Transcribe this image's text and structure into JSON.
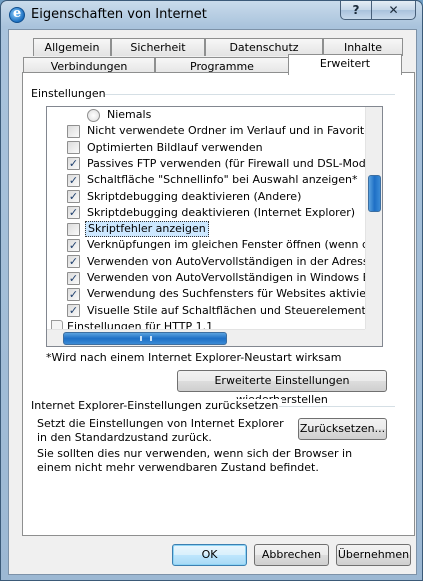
{
  "window": {
    "title": "Eigenschaften von Internet",
    "help_glyph": "?",
    "close_glyph": "✕"
  },
  "tabs_row1": [
    "Allgemein",
    "Sicherheit",
    "Datenschutz",
    "Inhalte"
  ],
  "tabs_row2": [
    "Verbindungen",
    "Programme",
    "Erweitert"
  ],
  "active_tab": "Erweitert",
  "settings": {
    "group_label": "Einstellungen",
    "items": [
      {
        "type": "radio",
        "label": "Niemals",
        "checked": false
      },
      {
        "type": "check",
        "label": "Nicht verwendete Ordner im Verlauf und in Favoriten schlie",
        "checked": false
      },
      {
        "type": "check",
        "label": "Optimierten Bildlauf verwenden",
        "checked": false
      },
      {
        "type": "check",
        "label": "Passives FTP verwenden (für Firewall und DSL-Modem-Kor",
        "checked": true
      },
      {
        "type": "check",
        "label": "Schaltfläche \"Schnellinfo\" bei Auswahl anzeigen*",
        "checked": true
      },
      {
        "type": "check",
        "label": "Skriptdebugging deaktivieren (Andere)",
        "checked": true
      },
      {
        "type": "check",
        "label": "Skriptdebugging deaktivieren (Internet Explorer)",
        "checked": true
      },
      {
        "type": "check",
        "label": "Skriptfehler anzeigen",
        "checked": false,
        "selected": true
      },
      {
        "type": "check",
        "label": "Verknüpfungen im gleichen Fenster öffnen (wenn die Regi",
        "checked": true
      },
      {
        "type": "check",
        "label": "Verwenden von AutoVervollständigen in der Adressleiste u",
        "checked": true
      },
      {
        "type": "check",
        "label": "Verwenden von AutoVervollständigen in Windows Explorer",
        "checked": true
      },
      {
        "type": "check",
        "label": "Verwendung des Suchfensters für Websites aktivieren*",
        "checked": true
      },
      {
        "type": "check",
        "label": "Visuelle Stile auf Schaltflächen und Steuerelementen in We",
        "checked": true
      },
      {
        "type": "folder",
        "label": "Einstellungen für HTTP 1.1",
        "checked": false
      }
    ],
    "restart_note": "*Wird nach einem Internet Explorer-Neustart wirksam",
    "restore_button": "Erweiterte Einstellungen wiederherstellen"
  },
  "reset": {
    "group_label": "Internet Explorer-Einstellungen zurücksetzen",
    "desc1": "Setzt die Einstellungen von Internet Explorer in den Standardzustand zurück.",
    "button": "Zurücksetzen...",
    "desc2": "Sie sollten dies nur verwenden, wenn sich der Browser in einem nicht mehr verwendbaren Zustand befindet."
  },
  "footer": {
    "ok": "OK",
    "cancel": "Abbrechen",
    "apply": "Übernehmen"
  }
}
